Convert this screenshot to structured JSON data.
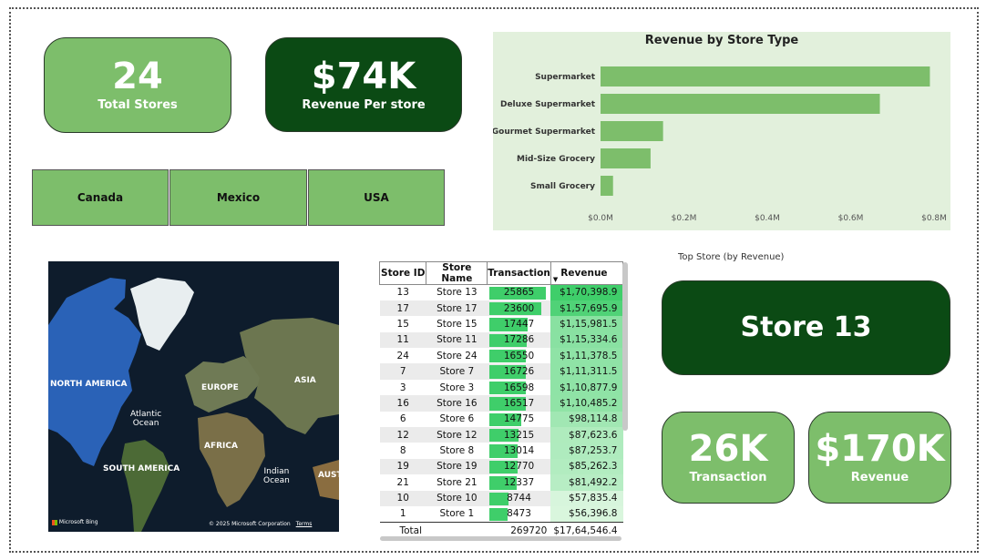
{
  "kpis": {
    "total_stores": {
      "value": "24",
      "label": "Total Stores"
    },
    "revenue_per_store": {
      "value": "$74K",
      "label": "Revenue Per store"
    },
    "top_store": {
      "title": "Top Store (by Revenue)",
      "value": "Store 13"
    },
    "transaction": {
      "value": "26K",
      "label": "Transaction"
    },
    "revenue": {
      "value": "$170K",
      "label": "Revenue"
    }
  },
  "country_slicer": [
    "Canada",
    "Mexico",
    "USA"
  ],
  "chart_data": {
    "type": "bar",
    "orientation": "horizontal",
    "title": "Revenue by Store Type",
    "categories": [
      "Supermarket",
      "Deluxe Supermarket",
      "Gourmet Supermarket",
      "Mid-Size Grocery",
      "Small Grocery"
    ],
    "values": [
      0.79,
      0.67,
      0.15,
      0.12,
      0.03
    ],
    "x_ticks": [
      "$0.0M",
      "$0.2M",
      "$0.4M",
      "$0.6M",
      "$0.8M"
    ],
    "xlim": [
      0,
      0.8
    ],
    "bar_color": "#7dbe6b",
    "background": "#e2f0dc"
  },
  "map": {
    "labels": {
      "north_america": "NORTH AMERICA",
      "europe": "EUROPE",
      "asia": "ASIA",
      "atlantic": "Atlantic\nOcean",
      "africa": "AFRICA",
      "south_america": "SOUTH AMERICA",
      "indian": "Indian\nOcean",
      "aust": "AUST"
    },
    "attribution_left": "Microsoft Bing",
    "attribution_right": "© 2025 Microsoft Corporation",
    "terms": "Terms"
  },
  "table": {
    "columns": [
      "Store ID",
      "Store Name",
      "Transaction",
      "Revenue"
    ],
    "sort_indicator": "▼",
    "max_transaction": 25865,
    "rows": [
      {
        "id": "13",
        "name": "Store 13",
        "tx": 25865,
        "rev": "$1,70,398.9",
        "rev_num": 170398.9
      },
      {
        "id": "17",
        "name": "Store 17",
        "tx": 23600,
        "rev": "$1,57,695.9",
        "rev_num": 157695.9
      },
      {
        "id": "15",
        "name": "Store 15",
        "tx": 17447,
        "rev": "$1,15,981.5",
        "rev_num": 115981.5
      },
      {
        "id": "11",
        "name": "Store 11",
        "tx": 17286,
        "rev": "$1,15,334.6",
        "rev_num": 115334.6
      },
      {
        "id": "24",
        "name": "Store 24",
        "tx": 16550,
        "rev": "$1,11,378.5",
        "rev_num": 111378.5
      },
      {
        "id": "7",
        "name": "Store 7",
        "tx": 16726,
        "rev": "$1,11,311.5",
        "rev_num": 111311.5
      },
      {
        "id": "3",
        "name": "Store 3",
        "tx": 16598,
        "rev": "$1,10,877.9",
        "rev_num": 110877.9
      },
      {
        "id": "16",
        "name": "Store 16",
        "tx": 16517,
        "rev": "$1,10,485.2",
        "rev_num": 110485.2
      },
      {
        "id": "6",
        "name": "Store 6",
        "tx": 14775,
        "rev": "$98,114.8",
        "rev_num": 98114.8
      },
      {
        "id": "12",
        "name": "Store 12",
        "tx": 13215,
        "rev": "$87,623.6",
        "rev_num": 87623.6
      },
      {
        "id": "8",
        "name": "Store 8",
        "tx": 13014,
        "rev": "$87,253.7",
        "rev_num": 87253.7
      },
      {
        "id": "19",
        "name": "Store 19",
        "tx": 12770,
        "rev": "$85,262.3",
        "rev_num": 85262.3
      },
      {
        "id": "21",
        "name": "Store 21",
        "tx": 12337,
        "rev": "$81,492.2",
        "rev_num": 81492.2
      },
      {
        "id": "10",
        "name": "Store 10",
        "tx": 8744,
        "rev": "$57,835.4",
        "rev_num": 57835.4
      },
      {
        "id": "1",
        "name": "Store 1",
        "tx": 8473,
        "rev": "$56,396.8",
        "rev_num": 56396.8
      }
    ],
    "total": {
      "label": "Total",
      "tx": "269720",
      "rev": "$17,64,546.4"
    }
  },
  "colors": {
    "kpi_light": "#7dbe6b",
    "kpi_dark": "#0b4a14",
    "tx_bar": "#3fce6a",
    "rev_high": "#3fce6a",
    "rev_low": "#d9f6dd"
  }
}
